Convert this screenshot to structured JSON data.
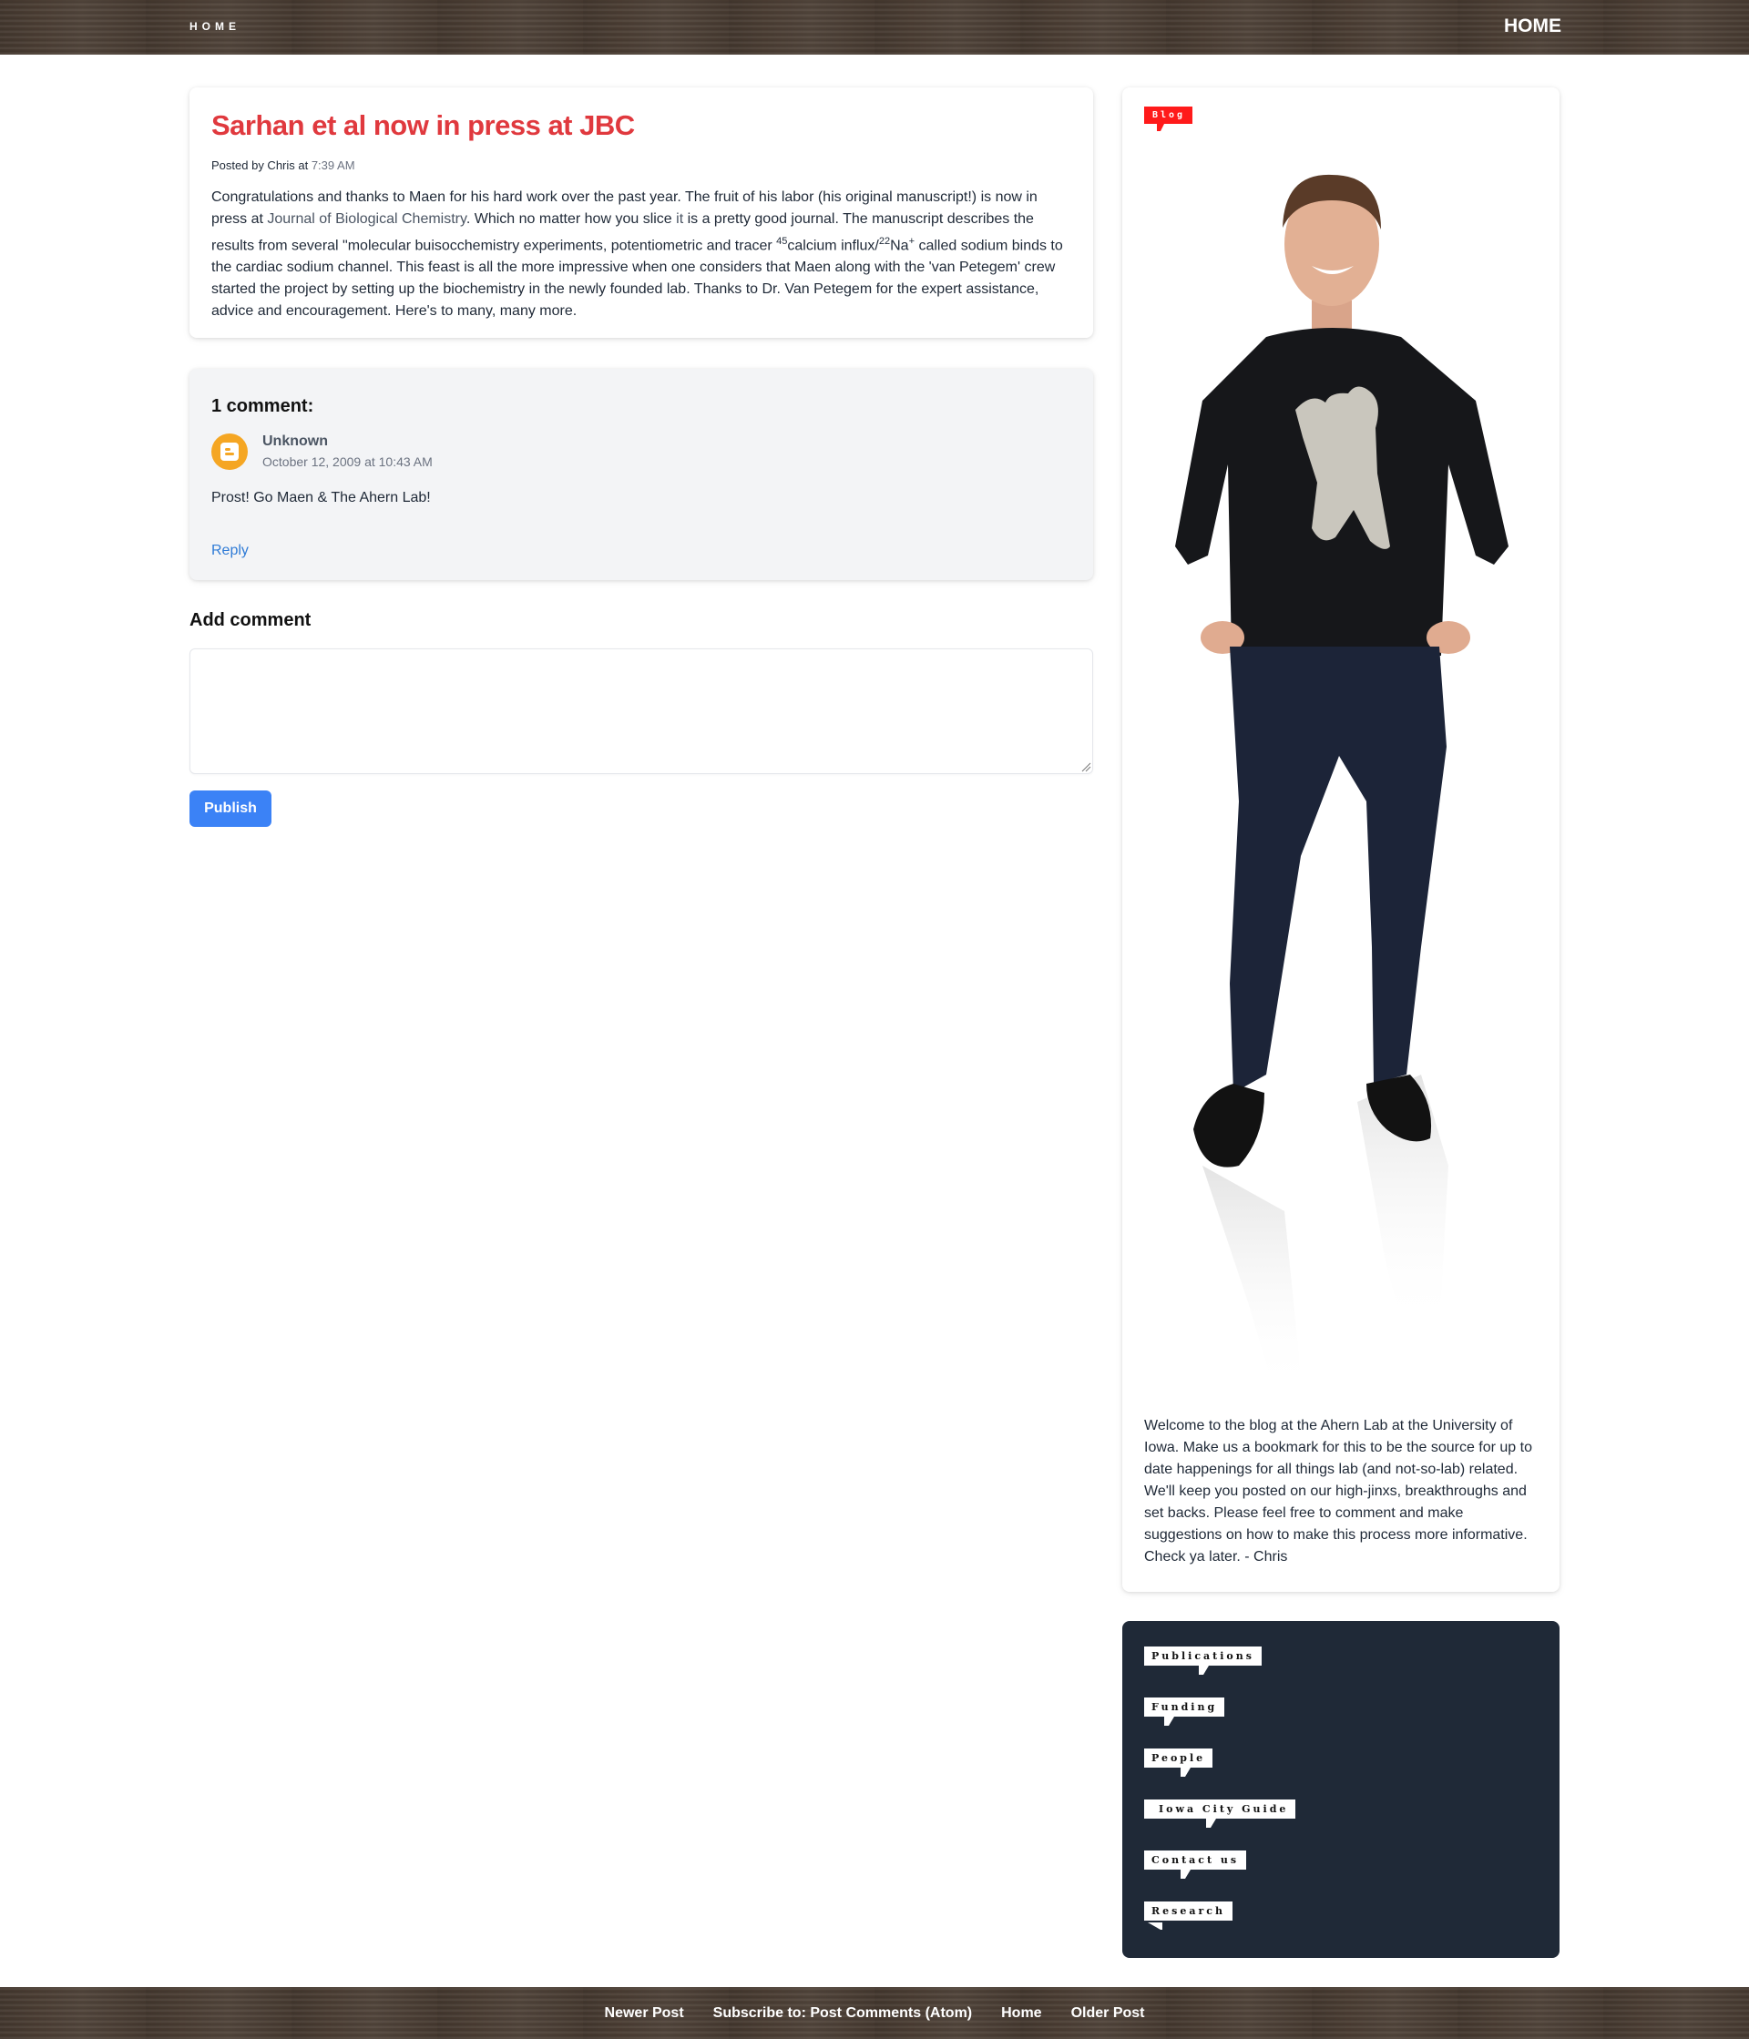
{
  "header": {
    "logo_text": "HOME",
    "nav_home": "HOME"
  },
  "post": {
    "title": "Sarhan et al now in press at JBC",
    "posted_by_prefix": "Posted by Chris at ",
    "time": "7:39 AM",
    "body_1": "Congratulations and thanks to Maen for his hard work over the past year. The fruit of his labor (his original manuscript!) is now in press at ",
    "link_journal": "Journal of Biological Chemistry",
    "body_2": ". Which no matter how you slice ",
    "link_it": "it",
    "body_3": " is a pretty good journal. The manuscript describes the results from several \"molecular buisocchemistry experiments, potentiometric and tracer ",
    "sup_45": "45",
    "body_4": "calcium influx/",
    "sup_22": "22",
    "body_5": "Na",
    "sup_plus": "+",
    "body_6": " called sodium binds to the cardiac sodium channel. This feast is all the more impressive when one considers that Maen along with the 'van Petegem' crew started the project by setting up the biochemistry in the newly founded lab. Thanks to Dr. Van Petegem for the expert assistance, advice and encouragement. Here's to many, many more."
  },
  "comments": {
    "title": "1 comment:",
    "items": [
      {
        "author": "Unknown",
        "date": "October 12, 2009 at 10:43 AM",
        "text": "Prost! Go Maen & The Ahern Lab!",
        "reply": "Reply"
      }
    ]
  },
  "add_comment": {
    "title": "Add comment",
    "placeholder": "",
    "publish_label": "Publish"
  },
  "sidebar": {
    "badge": "Blog",
    "welcome": "Welcome to the blog at the Ahern Lab at the University of Iowa. Make us a bookmark for this to be the source for up to date happenings for all things lab (and not-so-lab) related. We'll keep you posted on our high-jinxs, breakthroughs and set backs. Please feel free to comment and make suggestions on how to make this process more informative. Check ya later. - Chris",
    "links": [
      "Publications",
      "Funding",
      "People",
      "Iowa City Guide",
      "Contact us",
      "Research"
    ]
  },
  "footer": {
    "newer": "Newer Post",
    "subscribe": "Subscribe to: Post Comments (Atom)",
    "home": "Home",
    "older": "Older Post"
  },
  "colors": {
    "title_red": "#e0393e",
    "badge_red": "#ff1a1a",
    "publish_blue": "#3b82f6",
    "link_blue": "#2f7bd6",
    "links_panel": "#1f2937",
    "avatar_orange": "#f5a623"
  }
}
